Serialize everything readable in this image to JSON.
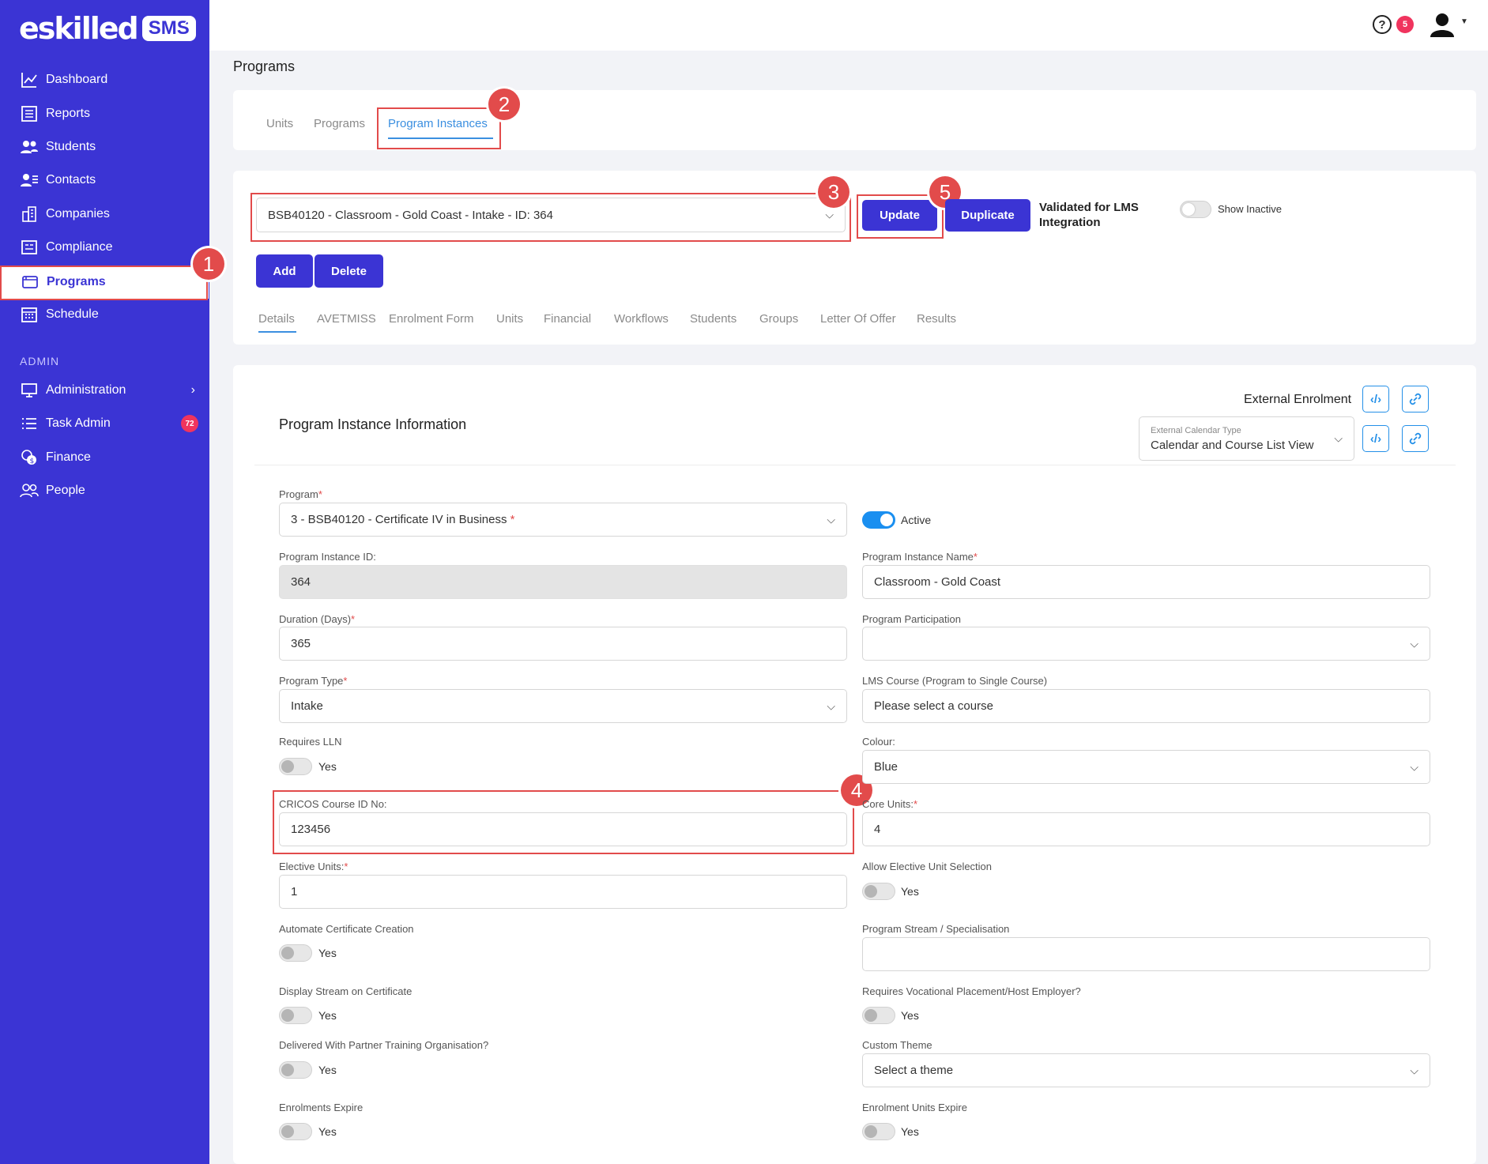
{
  "brand": {
    "logo": "eskilled",
    "badge": "SMS",
    "collapse_icon": "double-chevron-left-icon"
  },
  "nav": [
    {
      "label": "Dashboard",
      "icon": "chart-icon"
    },
    {
      "label": "Reports",
      "icon": "report-icon"
    },
    {
      "label": "Students",
      "icon": "students-icon"
    },
    {
      "label": "Contacts",
      "icon": "contacts-icon"
    },
    {
      "label": "Companies",
      "icon": "building-icon"
    },
    {
      "label": "Compliance",
      "icon": "compliance-icon"
    },
    {
      "label": "Programs",
      "icon": "programs-icon",
      "active": true
    },
    {
      "label": "Schedule",
      "icon": "calendar-icon"
    }
  ],
  "admin_label": "ADMIN",
  "admin_nav": [
    {
      "label": "Administration",
      "icon": "monitor-icon"
    },
    {
      "label": "Task Admin",
      "icon": "list-icon",
      "badge": "72"
    },
    {
      "label": "Finance",
      "icon": "coins-icon"
    },
    {
      "label": "People",
      "icon": "people-icon"
    }
  ],
  "topbar": {
    "help": "?",
    "notifications": "5"
  },
  "page_title": "Programs",
  "top_tabs": [
    "Units",
    "Programs",
    "Program Instances"
  ],
  "instance_select": "BSB40120 - Classroom - Gold Coast - Intake - ID: 364",
  "buttons": {
    "update": "Update",
    "duplicate": "Duplicate",
    "add": "Add",
    "delete": "Delete"
  },
  "validated": "Validated for LMS Integration",
  "show_inactive": "Show Inactive",
  "sub_tabs": [
    "Details",
    "AVETMISS",
    "Enrolment Form",
    "Units",
    "Financial",
    "Workflows",
    "Students",
    "Groups",
    "Letter Of Offer",
    "Results"
  ],
  "section_title": "Program Instance Information",
  "external_enrolment": "External Enrolment",
  "ext_calendar": {
    "label": "External Calendar Type",
    "value": "Calendar and Course List View"
  },
  "markers": [
    "1",
    "2",
    "3",
    "4",
    "5"
  ],
  "form": {
    "program": {
      "label": "Program",
      "value": "3 - BSB40120 - Certificate IV in Business"
    },
    "active": "Active",
    "instance_id": {
      "label": "Program Instance ID:",
      "value": "364"
    },
    "instance_name": {
      "label": "Program Instance Name",
      "value": "Classroom - Gold Coast"
    },
    "duration": {
      "label": "Duration (Days)",
      "value": "365"
    },
    "participation": {
      "label": "Program Participation",
      "value": ""
    },
    "program_type": {
      "label": "Program Type",
      "value": "Intake"
    },
    "lms_course": {
      "label": "LMS Course (Program to Single Course)",
      "value": "Please select a course"
    },
    "requires_lln": {
      "label": "Requires LLN",
      "toggle": "Yes"
    },
    "colour": {
      "label": "Colour:",
      "value": "Blue"
    },
    "cricos": {
      "label": "CRICOS Course ID No:",
      "value": "123456"
    },
    "core_units": {
      "label": "Core Units:",
      "value": "4"
    },
    "elective_units": {
      "label": "Elective Units:",
      "value": "1"
    },
    "allow_elective": {
      "label": "Allow Elective Unit Selection",
      "toggle": "Yes"
    },
    "auto_cert": {
      "label": "Automate Certificate Creation",
      "toggle": "Yes"
    },
    "stream": {
      "label": "Program Stream / Specialisation",
      "value": ""
    },
    "display_stream": {
      "label": "Display Stream on Certificate",
      "toggle": "Yes"
    },
    "vocational": {
      "label": "Requires Vocational Placement/Host Employer?",
      "toggle": "Yes"
    },
    "partner": {
      "label": "Delivered With Partner Training Organisation?",
      "toggle": "Yes"
    },
    "theme": {
      "label": "Custom Theme",
      "value": "Select a theme"
    },
    "enrol_expire": {
      "label": "Enrolments Expire",
      "toggle": "Yes"
    },
    "units_expire": {
      "label": "Enrolment Units Expire",
      "toggle": "Yes"
    }
  }
}
